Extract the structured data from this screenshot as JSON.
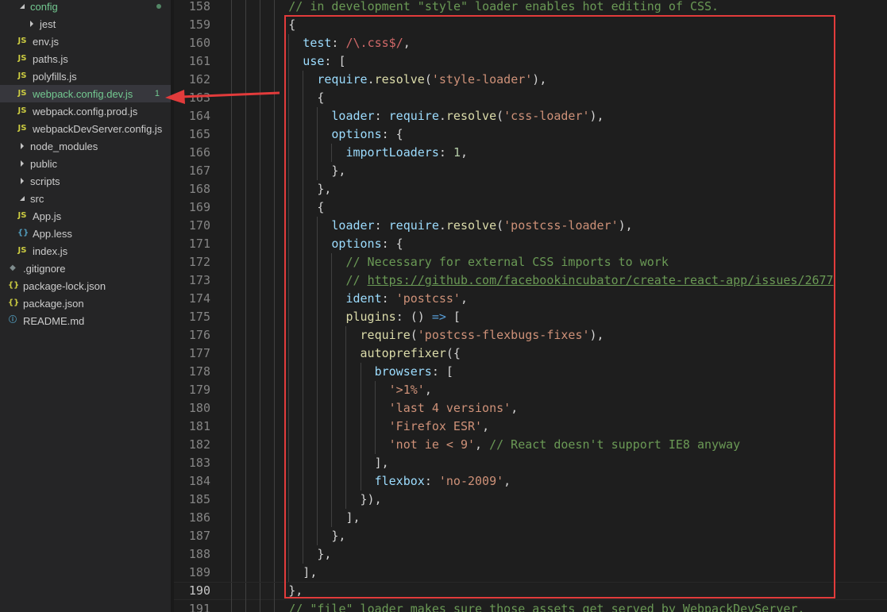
{
  "explorer": {
    "items": [
      {
        "name": "config",
        "kind": "folder-open",
        "depth": 0,
        "dot": true
      },
      {
        "name": "jest",
        "kind": "folder-closed",
        "depth": 1
      },
      {
        "name": "env.js",
        "kind": "js",
        "depth": 1
      },
      {
        "name": "paths.js",
        "kind": "js",
        "depth": 1
      },
      {
        "name": "polyfills.js",
        "kind": "js",
        "depth": 1
      },
      {
        "name": "webpack.config.dev.js",
        "kind": "js",
        "depth": 1,
        "selected": true,
        "modified": true,
        "badge": "1"
      },
      {
        "name": "webpack.config.prod.js",
        "kind": "js",
        "depth": 1
      },
      {
        "name": "webpackDevServer.config.js",
        "kind": "js",
        "depth": 1
      },
      {
        "name": "node_modules",
        "kind": "folder-closed",
        "depth": 0
      },
      {
        "name": "public",
        "kind": "folder-closed",
        "depth": 0
      },
      {
        "name": "scripts",
        "kind": "folder-closed",
        "depth": 0
      },
      {
        "name": "src",
        "kind": "folder-open",
        "depth": 0
      },
      {
        "name": "App.js",
        "kind": "js",
        "depth": 1
      },
      {
        "name": "App.less",
        "kind": "less",
        "depth": 1
      },
      {
        "name": "index.js",
        "kind": "js",
        "depth": 1
      },
      {
        "name": ".gitignore",
        "kind": "git",
        "depth": 0
      },
      {
        "name": "package-lock.json",
        "kind": "json",
        "depth": 0
      },
      {
        "name": "package.json",
        "kind": "json",
        "depth": 0
      },
      {
        "name": "README.md",
        "kind": "info",
        "depth": 0
      }
    ],
    "icon_glyphs": {
      "js": "JS",
      "json": "{}",
      "less": "{}",
      "git": "◆",
      "info": "ⓘ"
    }
  },
  "editor": {
    "current_line": 190,
    "lines": [
      {
        "n": 158,
        "indent": 4,
        "tokens": [
          [
            "cmt",
            "// in development \"style\" loader enables hot editing of CSS."
          ]
        ]
      },
      {
        "n": 159,
        "indent": 4,
        "tokens": [
          [
            "pun",
            "{"
          ]
        ]
      },
      {
        "n": 160,
        "indent": 5,
        "tokens": [
          [
            "prop",
            "test"
          ],
          [
            "pun",
            ": "
          ],
          [
            "re",
            "/\\.css$/"
          ],
          [
            "pun",
            ","
          ]
        ]
      },
      {
        "n": 161,
        "indent": 5,
        "tokens": [
          [
            "prop",
            "use"
          ],
          [
            "pun",
            ": ["
          ]
        ]
      },
      {
        "n": 162,
        "indent": 6,
        "tokens": [
          [
            "var",
            "require"
          ],
          [
            "pun",
            "."
          ],
          [
            "fn",
            "resolve"
          ],
          [
            "pun",
            "("
          ],
          [
            "str",
            "'style-loader'"
          ],
          [
            "pun",
            "),"
          ]
        ]
      },
      {
        "n": 163,
        "indent": 6,
        "tokens": [
          [
            "pun",
            "{"
          ]
        ]
      },
      {
        "n": 164,
        "indent": 7,
        "tokens": [
          [
            "prop",
            "loader"
          ],
          [
            "pun",
            ": "
          ],
          [
            "var",
            "require"
          ],
          [
            "pun",
            "."
          ],
          [
            "fn",
            "resolve"
          ],
          [
            "pun",
            "("
          ],
          [
            "str",
            "'css-loader'"
          ],
          [
            "pun",
            "),"
          ]
        ]
      },
      {
        "n": 165,
        "indent": 7,
        "tokens": [
          [
            "prop",
            "options"
          ],
          [
            "pun",
            ": {"
          ]
        ]
      },
      {
        "n": 166,
        "indent": 8,
        "tokens": [
          [
            "prop",
            "importLoaders"
          ],
          [
            "pun",
            ": "
          ],
          [
            "num",
            "1"
          ],
          [
            "pun",
            ","
          ]
        ]
      },
      {
        "n": 167,
        "indent": 7,
        "tokens": [
          [
            "pun",
            "},"
          ]
        ]
      },
      {
        "n": 168,
        "indent": 6,
        "tokens": [
          [
            "pun",
            "},"
          ]
        ]
      },
      {
        "n": 169,
        "indent": 6,
        "tokens": [
          [
            "pun",
            "{"
          ]
        ]
      },
      {
        "n": 170,
        "indent": 7,
        "tokens": [
          [
            "prop",
            "loader"
          ],
          [
            "pun",
            ": "
          ],
          [
            "var",
            "require"
          ],
          [
            "pun",
            "."
          ],
          [
            "fn",
            "resolve"
          ],
          [
            "pun",
            "("
          ],
          [
            "str",
            "'postcss-loader'"
          ],
          [
            "pun",
            "),"
          ]
        ]
      },
      {
        "n": 171,
        "indent": 7,
        "tokens": [
          [
            "prop",
            "options"
          ],
          [
            "pun",
            ": {"
          ]
        ]
      },
      {
        "n": 172,
        "indent": 8,
        "tokens": [
          [
            "cmt",
            "// Necessary for external CSS imports to work"
          ]
        ]
      },
      {
        "n": 173,
        "indent": 8,
        "tokens": [
          [
            "cmt",
            "// "
          ],
          [
            "link",
            "https://github.com/facebookincubator/create-react-app/issues/2677"
          ]
        ]
      },
      {
        "n": 174,
        "indent": 8,
        "tokens": [
          [
            "prop",
            "ident"
          ],
          [
            "pun",
            ": "
          ],
          [
            "str",
            "'postcss'"
          ],
          [
            "pun",
            ","
          ]
        ]
      },
      {
        "n": 175,
        "indent": 8,
        "tokens": [
          [
            "fn",
            "plugins"
          ],
          [
            "pun",
            ": () "
          ],
          [
            "op",
            "=>"
          ],
          [
            "pun",
            " ["
          ]
        ]
      },
      {
        "n": 176,
        "indent": 9,
        "tokens": [
          [
            "fn",
            "require"
          ],
          [
            "pun",
            "("
          ],
          [
            "str",
            "'postcss-flexbugs-fixes'"
          ],
          [
            "pun",
            "),"
          ]
        ]
      },
      {
        "n": 177,
        "indent": 9,
        "tokens": [
          [
            "fn",
            "autoprefixer"
          ],
          [
            "pun",
            "({"
          ]
        ]
      },
      {
        "n": 178,
        "indent": 10,
        "tokens": [
          [
            "prop",
            "browsers"
          ],
          [
            "pun",
            ": ["
          ]
        ]
      },
      {
        "n": 179,
        "indent": 11,
        "tokens": [
          [
            "str",
            "'>1%'"
          ],
          [
            "pun",
            ","
          ]
        ]
      },
      {
        "n": 180,
        "indent": 11,
        "tokens": [
          [
            "str",
            "'last 4 versions'"
          ],
          [
            "pun",
            ","
          ]
        ]
      },
      {
        "n": 181,
        "indent": 11,
        "tokens": [
          [
            "str",
            "'Firefox ESR'"
          ],
          [
            "pun",
            ","
          ]
        ]
      },
      {
        "n": 182,
        "indent": 11,
        "tokens": [
          [
            "str",
            "'not ie < 9'"
          ],
          [
            "pun",
            ", "
          ],
          [
            "cmt",
            "// React doesn't support IE8 anyway"
          ]
        ]
      },
      {
        "n": 183,
        "indent": 10,
        "tokens": [
          [
            "pun",
            "],"
          ]
        ]
      },
      {
        "n": 184,
        "indent": 10,
        "tokens": [
          [
            "prop",
            "flexbox"
          ],
          [
            "pun",
            ": "
          ],
          [
            "str",
            "'no-2009'"
          ],
          [
            "pun",
            ","
          ]
        ]
      },
      {
        "n": 185,
        "indent": 9,
        "tokens": [
          [
            "pun",
            "}),"
          ]
        ]
      },
      {
        "n": 186,
        "indent": 8,
        "tokens": [
          [
            "pun",
            "],"
          ]
        ]
      },
      {
        "n": 187,
        "indent": 7,
        "tokens": [
          [
            "pun",
            "},"
          ]
        ]
      },
      {
        "n": 188,
        "indent": 6,
        "tokens": [
          [
            "pun",
            "},"
          ]
        ]
      },
      {
        "n": 189,
        "indent": 5,
        "tokens": [
          [
            "pun",
            "],"
          ]
        ]
      },
      {
        "n": 190,
        "indent": 4,
        "tokens": [
          [
            "pun",
            "},"
          ]
        ]
      },
      {
        "n": 191,
        "indent": 4,
        "tokens": [
          [
            "cmt",
            "// \"file\" loader makes sure those assets get served by WebpackDevServer."
          ]
        ]
      }
    ]
  },
  "annotation": {
    "color": "#e23b3b"
  }
}
